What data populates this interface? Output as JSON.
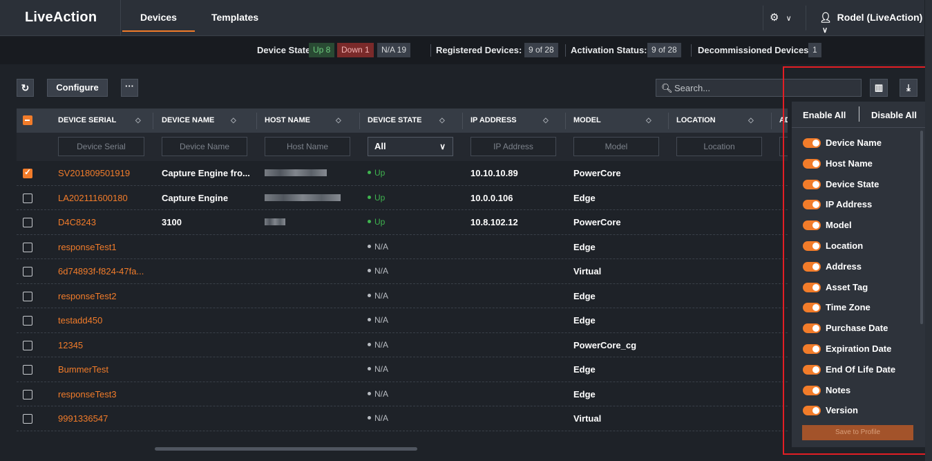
{
  "nav": {
    "logo": "LiveAction",
    "tabs": [
      {
        "label": "Devices",
        "active": true
      },
      {
        "label": "Templates",
        "active": false
      }
    ],
    "settings_icon": "gear-icon",
    "user": "Rodel (LiveAction)"
  },
  "status": {
    "device_state_label": "Device State:",
    "up": "Up 8",
    "down": "Down 1",
    "na": "N/A 19",
    "registered_label": "Registered Devices:",
    "registered_value": "9 of 28",
    "activation_label": "Activation Status:",
    "activation_value": "9 of 28",
    "decommissioned_label": "Decommissioned Devices:",
    "decommissioned_value": "1"
  },
  "toolbar": {
    "refresh_icon": "refresh-icon",
    "configure": "Configure",
    "more": "···",
    "search_placeholder": "Search..."
  },
  "table": {
    "columns": [
      "DEVICE SERIAL",
      "DEVICE NAME",
      "HOST NAME",
      "DEVICE STATE",
      "IP ADDRESS",
      "MODEL",
      "LOCATION",
      "AD"
    ],
    "filters": {
      "serial": "Device Serial",
      "name": "Device Name",
      "host": "Host Name",
      "state": "All",
      "ip": "IP Address",
      "model": "Model",
      "location": "Location"
    },
    "rows": [
      {
        "checked": true,
        "serial": "SV201809501919",
        "name": "Capture Engine fro...",
        "host_blur": 90,
        "state": "Up",
        "ip": "10.10.10.89",
        "model": "PowerCore"
      },
      {
        "checked": false,
        "serial": "LA202111600180",
        "name": "Capture Engine",
        "host_blur": 110,
        "state": "Up",
        "ip": "10.0.0.106",
        "model": "Edge"
      },
      {
        "checked": false,
        "serial": "D4C8243",
        "name": "3100",
        "host_blur": 30,
        "state": "Up",
        "ip": "10.8.102.12",
        "model": "PowerCore"
      },
      {
        "checked": false,
        "serial": "responseTest1",
        "name": "",
        "host_blur": 0,
        "state": "N/A",
        "ip": "",
        "model": "Edge"
      },
      {
        "checked": false,
        "serial": "6d74893f-f824-47fa...",
        "name": "",
        "host_blur": 0,
        "state": "N/A",
        "ip": "",
        "model": "Virtual"
      },
      {
        "checked": false,
        "serial": "responseTest2",
        "name": "",
        "host_blur": 0,
        "state": "N/A",
        "ip": "",
        "model": "Edge"
      },
      {
        "checked": false,
        "serial": "testadd450",
        "name": "",
        "host_blur": 0,
        "state": "N/A",
        "ip": "",
        "model": "Edge"
      },
      {
        "checked": false,
        "serial": "12345",
        "name": "",
        "host_blur": 0,
        "state": "N/A",
        "ip": "",
        "model": "PowerCore_cg"
      },
      {
        "checked": false,
        "serial": "BummerTest",
        "name": "",
        "host_blur": 0,
        "state": "N/A",
        "ip": "",
        "model": "Edge"
      },
      {
        "checked": false,
        "serial": "responseTest3",
        "name": "",
        "host_blur": 0,
        "state": "N/A",
        "ip": "",
        "model": "Edge"
      },
      {
        "checked": false,
        "serial": "9991336547",
        "name": "",
        "host_blur": 0,
        "state": "N/A",
        "ip": "",
        "model": "Virtual"
      }
    ]
  },
  "column_panel": {
    "enable_all": "Enable All",
    "disable_all": "Disable All",
    "items": [
      {
        "label": "Device Name",
        "enabled": true
      },
      {
        "label": "Host Name",
        "enabled": true
      },
      {
        "label": "Device State",
        "enabled": true
      },
      {
        "label": "IP Address",
        "enabled": true
      },
      {
        "label": "Model",
        "enabled": true
      },
      {
        "label": "Location",
        "enabled": true
      },
      {
        "label": "Address",
        "enabled": true
      },
      {
        "label": "Asset Tag",
        "enabled": true
      },
      {
        "label": "Time Zone",
        "enabled": true
      },
      {
        "label": "Purchase Date",
        "enabled": true
      },
      {
        "label": "Expiration Date",
        "enabled": true
      },
      {
        "label": "End Of Life Date",
        "enabled": true
      },
      {
        "label": "Notes",
        "enabled": true
      },
      {
        "label": "Version",
        "enabled": true
      }
    ],
    "save": "Save to Profile"
  },
  "colors": {
    "accent": "#f27c2a",
    "up": "#3fb54f",
    "down": "#7a2a2a",
    "highlight": "#e31e24"
  }
}
